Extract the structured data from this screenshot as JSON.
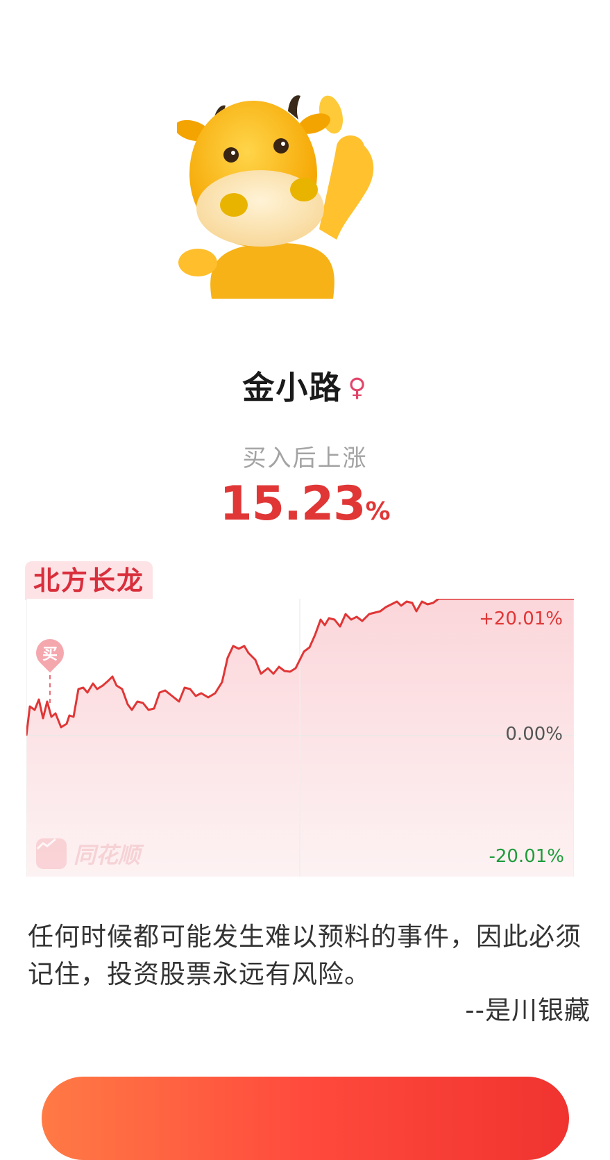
{
  "profile": {
    "name": "金小路",
    "gender_symbol": "♀"
  },
  "performance": {
    "label": "买入后上涨",
    "value": "15.23",
    "unit": "%"
  },
  "stock": {
    "name": "北方长龙",
    "buy_marker": "买",
    "axis_labels": {
      "top": "+20.01%",
      "mid": "0.00%",
      "bottom": "-20.01%"
    },
    "watermark": "同花顺",
    "colors": {
      "line": "#e03636",
      "up": "#e03636",
      "down": "#1f9c3a"
    }
  },
  "quote": {
    "text": "任何时候都可能发生难以预料的事件，因此必须记住，投资股票永远有风险。",
    "author": "--是川银藏"
  },
  "icons": {
    "mascot": "cow-mascot-thumbs-up",
    "watermark": "tonghuashun-logo-icon"
  }
}
